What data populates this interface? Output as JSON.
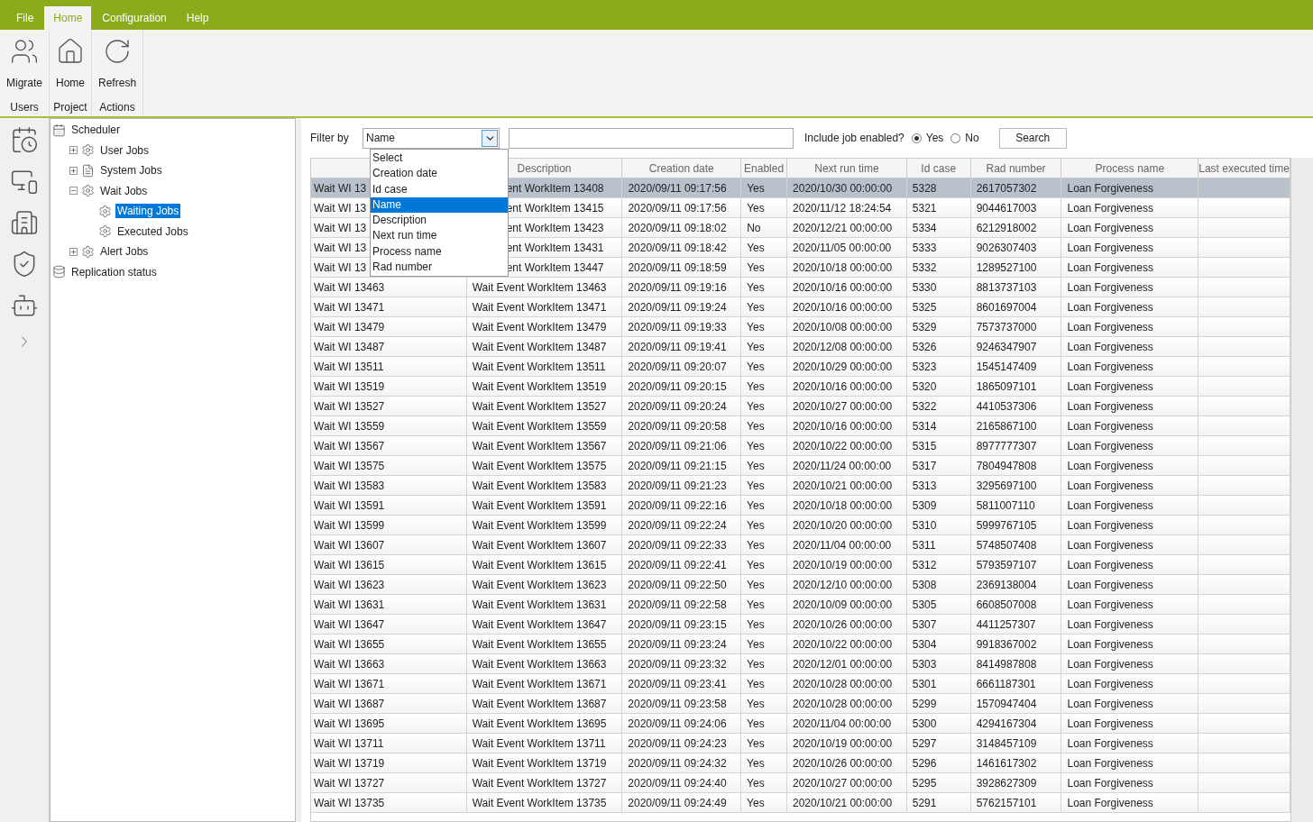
{
  "menu_tabs": [
    {
      "label": "File",
      "selected": false
    },
    {
      "label": "Home",
      "selected": true
    },
    {
      "label": "Configuration",
      "selected": false
    },
    {
      "label": "Help",
      "selected": false
    }
  ],
  "ribbon_groups": [
    {
      "label": "Users",
      "buttons": [
        {
          "kind": "migrate",
          "label": "Migrate"
        }
      ]
    },
    {
      "label": "Project",
      "buttons": [
        {
          "kind": "home",
          "label": "Home"
        }
      ]
    },
    {
      "label": "Actions",
      "buttons": [
        {
          "kind": "refresh",
          "label": "Refresh"
        }
      ]
    }
  ],
  "side_icons": [
    {
      "kind": "calendar"
    },
    {
      "kind": "devices"
    },
    {
      "kind": "buildings"
    },
    {
      "kind": "shield"
    },
    {
      "kind": "robot"
    },
    {
      "kind": "chevron"
    }
  ],
  "tree": [
    {
      "label": "Scheduler",
      "kind": "calendar",
      "selected": false,
      "children": [
        {
          "label": "User Jobs",
          "kind": "gear",
          "selected": false,
          "expanded": false
        },
        {
          "label": "System Jobs",
          "kind": "doc",
          "selected": false,
          "expanded": false
        },
        {
          "label": "Wait Jobs",
          "kind": "gear",
          "selected": false,
          "expanded": true,
          "children": [
            {
              "label": "Waiting Jobs",
              "kind": "gear",
              "selected": true
            },
            {
              "label": "Executed Jobs",
              "kind": "gear",
              "selected": false
            }
          ]
        },
        {
          "label": "Alert Jobs",
          "kind": "gear",
          "selected": false,
          "expanded": false
        }
      ]
    },
    {
      "label": "Replication status",
      "kind": "db",
      "selected": false
    }
  ],
  "filter": {
    "label": "Filter by",
    "value": "Name",
    "options": [
      {
        "label": "Select",
        "selected": false
      },
      {
        "label": "Creation date",
        "selected": false
      },
      {
        "label": "Id case",
        "selected": false
      },
      {
        "label": "Name",
        "selected": true
      },
      {
        "label": "Description",
        "selected": false
      },
      {
        "label": "Next run time",
        "selected": false
      },
      {
        "label": "Process name",
        "selected": false
      },
      {
        "label": "Rad number",
        "selected": false
      }
    ]
  },
  "include_enabled": {
    "label": "Include job enabled?",
    "options": [
      {
        "label": "Yes",
        "selected": true
      },
      {
        "label": "No",
        "selected": false
      }
    ]
  },
  "search_button": "Search",
  "table": {
    "columns": [
      "",
      "Description",
      "Creation date",
      "Enabled",
      "Next run time",
      "Id case",
      "Rad number",
      "Process name",
      "Last executed time"
    ],
    "rows": [
      {
        "selected": true,
        "cells": [
          "Wait WI 13",
          "ent WorkItem 13408",
          "2020/09/11 09:17:56",
          "Yes",
          "2020/10/30 00:00:00",
          "5328",
          "2617057302",
          "Loan Forgiveness"
        ]
      },
      {
        "selected": false,
        "cells": [
          "Wait WI 13",
          "ent WorkItem 13415",
          "2020/09/11 09:17:56",
          "Yes",
          "2020/11/12 18:24:54",
          "5321",
          "9044617003",
          "Loan Forgiveness"
        ]
      },
      {
        "selected": false,
        "cells": [
          "Wait WI 13",
          "ent WorkItem 13423",
          "2020/09/11 09:18:02",
          "No",
          "2020/12/21 00:00:00",
          "5334",
          "6212918002",
          "Loan Forgiveness"
        ]
      },
      {
        "selected": false,
        "cells": [
          "Wait WI 13",
          "ent WorkItem 13431",
          "2020/09/11 09:18:42",
          "Yes",
          "2020/11/05 00:00:00",
          "5333",
          "9026307403",
          "Loan Forgiveness"
        ]
      },
      {
        "selected": false,
        "cells": [
          "Wait WI 13",
          "ent WorkItem 13447",
          "2020/09/11 09:18:59",
          "Yes",
          "2020/10/18 00:00:00",
          "5332",
          "1289527100",
          "Loan Forgiveness"
        ]
      },
      {
        "selected": false,
        "cells": [
          "Wait WI 13463",
          "Wait Event WorkItem 13463",
          "2020/09/11 09:19:16",
          "Yes",
          "2020/10/16 00:00:00",
          "5330",
          "8813737103",
          "Loan Forgiveness"
        ]
      },
      {
        "selected": false,
        "cells": [
          "Wait WI 13471",
          "Wait Event WorkItem 13471",
          "2020/09/11 09:19:24",
          "Yes",
          "2020/10/16 00:00:00",
          "5325",
          "8601697004",
          "Loan Forgiveness"
        ]
      },
      {
        "selected": false,
        "cells": [
          "Wait WI 13479",
          "Wait Event WorkItem 13479",
          "2020/09/11 09:19:33",
          "Yes",
          "2020/10/08 00:00:00",
          "5329",
          "7573737000",
          "Loan Forgiveness"
        ]
      },
      {
        "selected": false,
        "cells": [
          "Wait WI 13487",
          "Wait Event WorkItem 13487",
          "2020/09/11 09:19:41",
          "Yes",
          "2020/12/08 00:00:00",
          "5326",
          "9246347907",
          "Loan Forgiveness"
        ]
      },
      {
        "selected": false,
        "cells": [
          "Wait WI 13511",
          "Wait Event WorkItem 13511",
          "2020/09/11 09:20:07",
          "Yes",
          "2020/10/29 00:00:00",
          "5323",
          "1545147409",
          "Loan Forgiveness"
        ]
      },
      {
        "selected": false,
        "cells": [
          "Wait WI 13519",
          "Wait Event WorkItem 13519",
          "2020/09/11 09:20:15",
          "Yes",
          "2020/10/16 00:00:00",
          "5320",
          "1865097101",
          "Loan Forgiveness"
        ]
      },
      {
        "selected": false,
        "cells": [
          "Wait WI 13527",
          "Wait Event WorkItem 13527",
          "2020/09/11 09:20:24",
          "Yes",
          "2020/10/27 00:00:00",
          "5322",
          "4410537306",
          "Loan Forgiveness"
        ]
      },
      {
        "selected": false,
        "cells": [
          "Wait WI 13559",
          "Wait Event WorkItem 13559",
          "2020/09/11 09:20:58",
          "Yes",
          "2020/10/16 00:00:00",
          "5314",
          "2165867100",
          "Loan Forgiveness"
        ]
      },
      {
        "selected": false,
        "cells": [
          "Wait WI 13567",
          "Wait Event WorkItem 13567",
          "2020/09/11 09:21:06",
          "Yes",
          "2020/10/22 00:00:00",
          "5315",
          "8977777307",
          "Loan Forgiveness"
        ]
      },
      {
        "selected": false,
        "cells": [
          "Wait WI 13575",
          "Wait Event WorkItem 13575",
          "2020/09/11 09:21:15",
          "Yes",
          "2020/11/24 00:00:00",
          "5317",
          "7804947808",
          "Loan Forgiveness"
        ]
      },
      {
        "selected": false,
        "cells": [
          "Wait WI 13583",
          "Wait Event WorkItem 13583",
          "2020/09/11 09:21:23",
          "Yes",
          "2020/10/21 00:00:00",
          "5313",
          "3295697100",
          "Loan Forgiveness"
        ]
      },
      {
        "selected": false,
        "cells": [
          "Wait WI 13591",
          "Wait Event WorkItem 13591",
          "2020/09/11 09:22:16",
          "Yes",
          "2020/10/18 00:00:00",
          "5309",
          "5811007110",
          "Loan Forgiveness"
        ]
      },
      {
        "selected": false,
        "cells": [
          "Wait WI 13599",
          "Wait Event WorkItem 13599",
          "2020/09/11 09:22:24",
          "Yes",
          "2020/10/20 00:00:00",
          "5310",
          "5999767105",
          "Loan Forgiveness"
        ]
      },
      {
        "selected": false,
        "cells": [
          "Wait WI 13607",
          "Wait Event WorkItem 13607",
          "2020/09/11 09:22:33",
          "Yes",
          "2020/11/04 00:00:00",
          "5311",
          "5748507408",
          "Loan Forgiveness"
        ]
      },
      {
        "selected": false,
        "cells": [
          "Wait WI 13615",
          "Wait Event WorkItem 13615",
          "2020/09/11 09:22:41",
          "Yes",
          "2020/10/19 00:00:00",
          "5312",
          "5793597107",
          "Loan Forgiveness"
        ]
      },
      {
        "selected": false,
        "cells": [
          "Wait WI 13623",
          "Wait Event WorkItem 13623",
          "2020/09/11 09:22:50",
          "Yes",
          "2020/12/10 00:00:00",
          "5308",
          "2369138004",
          "Loan Forgiveness"
        ]
      },
      {
        "selected": false,
        "cells": [
          "Wait WI 13631",
          "Wait Event WorkItem 13631",
          "2020/09/11 09:22:58",
          "Yes",
          "2020/10/09 00:00:00",
          "5305",
          "6608507008",
          "Loan Forgiveness"
        ]
      },
      {
        "selected": false,
        "cells": [
          "Wait WI 13647",
          "Wait Event WorkItem 13647",
          "2020/09/11 09:23:15",
          "Yes",
          "2020/10/26 00:00:00",
          "5307",
          "4411257307",
          "Loan Forgiveness"
        ]
      },
      {
        "selected": false,
        "cells": [
          "Wait WI 13655",
          "Wait Event WorkItem 13655",
          "2020/09/11 09:23:24",
          "Yes",
          "2020/10/22 00:00:00",
          "5304",
          "9918367002",
          "Loan Forgiveness"
        ]
      },
      {
        "selected": false,
        "cells": [
          "Wait WI 13663",
          "Wait Event WorkItem 13663",
          "2020/09/11 09:23:32",
          "Yes",
          "2020/12/01 00:00:00",
          "5303",
          "8414987808",
          "Loan Forgiveness"
        ]
      },
      {
        "selected": false,
        "cells": [
          "Wait WI 13671",
          "Wait Event WorkItem 13671",
          "2020/09/11 09:23:41",
          "Yes",
          "2020/10/28 00:00:00",
          "5301",
          "6661187301",
          "Loan Forgiveness"
        ]
      },
      {
        "selected": false,
        "cells": [
          "Wait WI 13687",
          "Wait Event WorkItem 13687",
          "2020/09/11 09:23:58",
          "Yes",
          "2020/10/28 00:00:00",
          "5299",
          "1570947404",
          "Loan Forgiveness"
        ]
      },
      {
        "selected": false,
        "cells": [
          "Wait WI 13695",
          "Wait Event WorkItem 13695",
          "2020/09/11 09:24:06",
          "Yes",
          "2020/11/04 00:00:00",
          "5300",
          "4294167304",
          "Loan Forgiveness"
        ]
      },
      {
        "selected": false,
        "cells": [
          "Wait WI 13711",
          "Wait Event WorkItem 13711",
          "2020/09/11 09:24:23",
          "Yes",
          "2020/10/19 00:00:00",
          "5297",
          "3148457109",
          "Loan Forgiveness"
        ]
      },
      {
        "selected": false,
        "cells": [
          "Wait WI 13719",
          "Wait Event WorkItem 13719",
          "2020/09/11 09:24:32",
          "Yes",
          "2020/10/26 00:00:00",
          "5296",
          "1461617302",
          "Loan Forgiveness"
        ]
      },
      {
        "selected": false,
        "cells": [
          "Wait WI 13727",
          "Wait Event WorkItem 13727",
          "2020/09/11 09:24:40",
          "Yes",
          "2020/10/27 00:00:00",
          "5295",
          "3928627309",
          "Loan Forgiveness"
        ]
      },
      {
        "selected": false,
        "cells": [
          "Wait WI 13735",
          "Wait Event WorkItem 13735",
          "2020/09/11 09:24:49",
          "Yes",
          "2020/10/21 00:00:00",
          "5291",
          "5762157101",
          "Loan Forgiveness"
        ]
      }
    ]
  }
}
